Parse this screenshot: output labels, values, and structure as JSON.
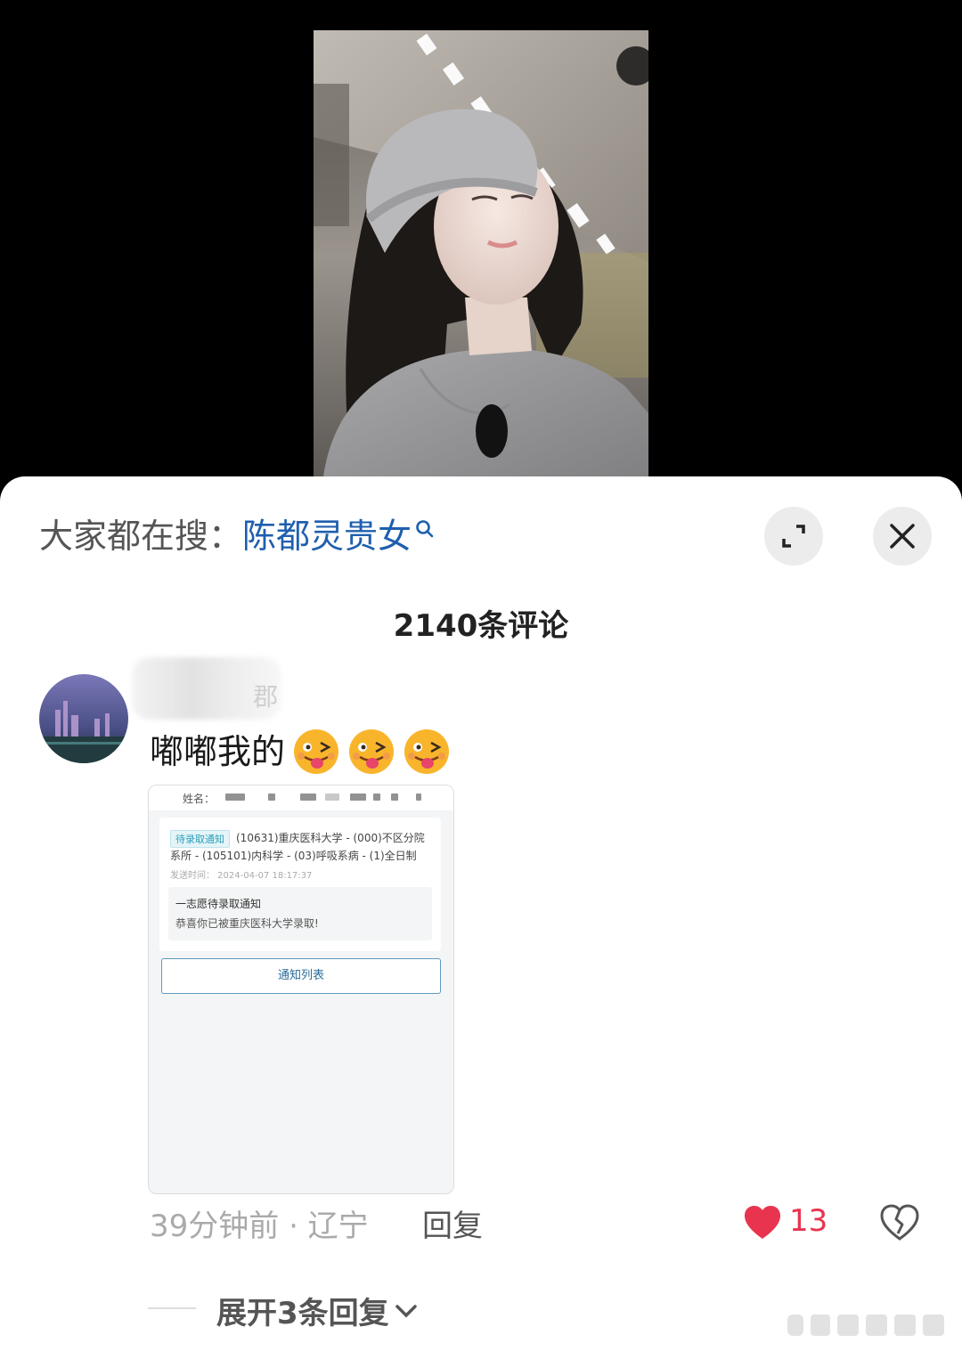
{
  "search_hint": {
    "prefix": "大家都在搜：",
    "keyword": "陈都灵贵女"
  },
  "header": {
    "comment_count": "2140条评论"
  },
  "comment": {
    "username_tail": "郡",
    "text": "嘟嘟我的",
    "emoji_name": "tongue-wink-emoji",
    "time_location": "39分钟前 · 辽宁",
    "reply_label": "回复",
    "like_count": "13",
    "like_color": "#e8344f",
    "expand_replies_label": "展开3条回复"
  },
  "attachment": {
    "name_label": "姓名：",
    "tag": "待录取通知",
    "line1": "(10631)重庆医科大学 - (000)不区分院",
    "line2": "系所 - (105101)内科学 - (03)呼吸系病 - (1)全日制",
    "time": "发送时间：  2024-04-07 18:17:37",
    "inner_title": "一志愿待录取通知",
    "inner_body": "恭喜你已被重庆医科大学录取!",
    "button_label": "通知列表"
  },
  "colors": {
    "keyword_blue": "#1f5fae",
    "sheet_bg": "#ffffff",
    "video_bg": "#000000"
  }
}
